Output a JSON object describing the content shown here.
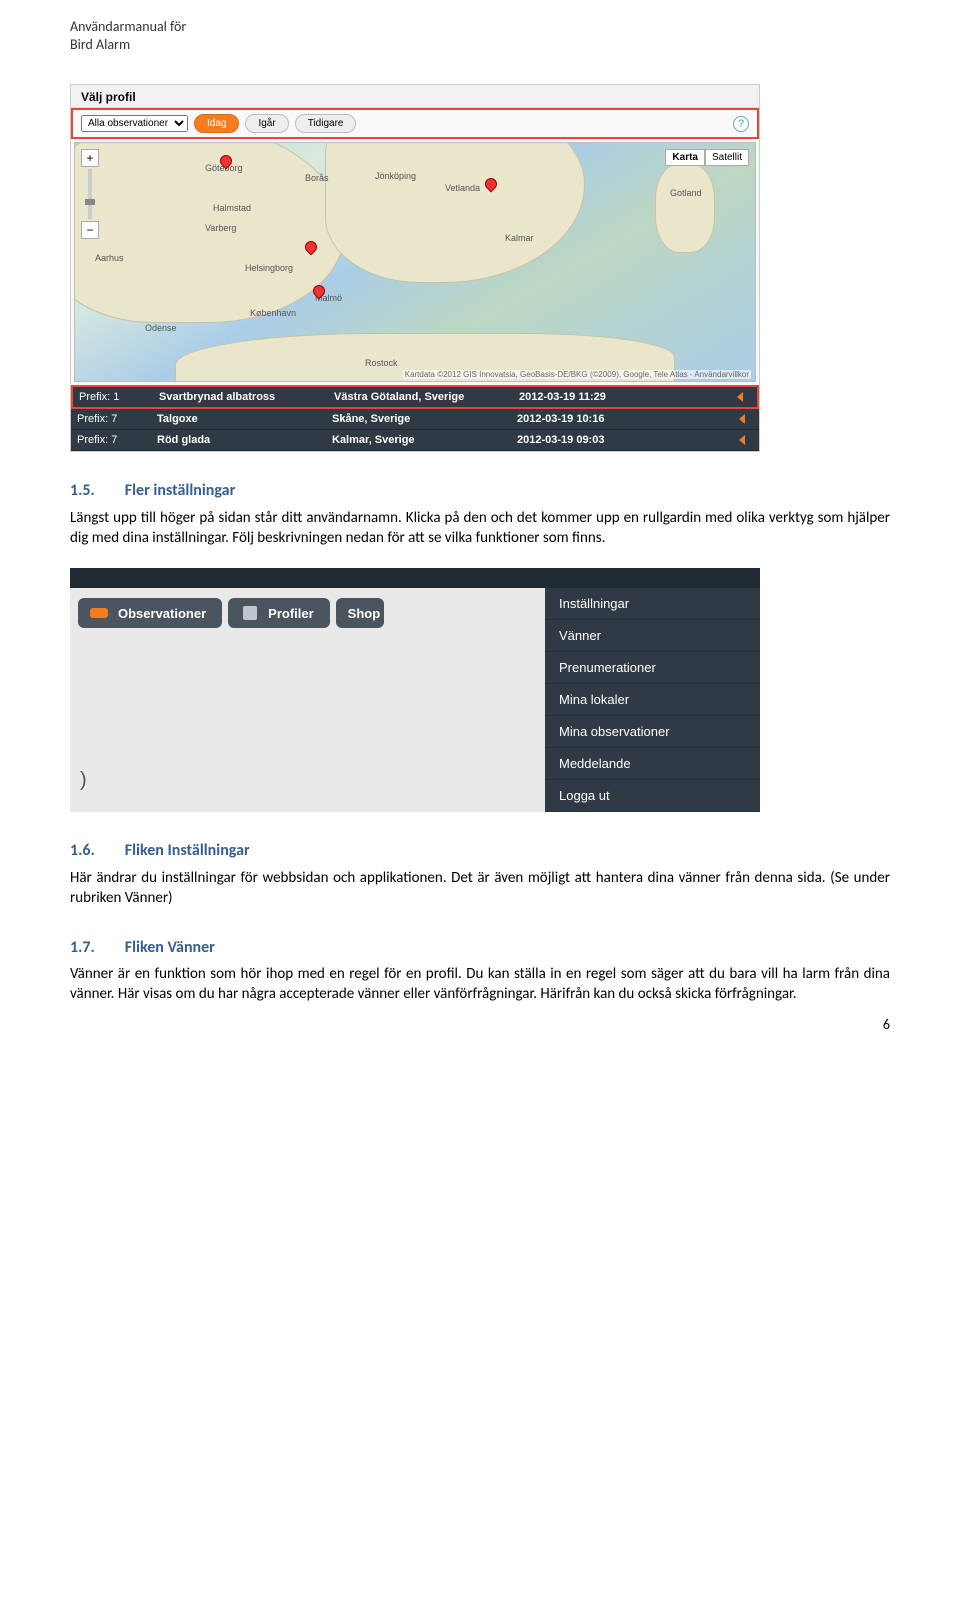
{
  "header": {
    "line1": "Användarmanual för",
    "line2": "Bird Alarm"
  },
  "shot1": {
    "profileLabel": "Välj profil",
    "dropdown": "Alla observationer",
    "btnIdag": "Idag",
    "btnIgar": "Igår",
    "btnTidigare": "Tidigare",
    "mapKarta": "Karta",
    "mapSatellit": "Satellit",
    "attrib": "Kartdata ©2012 GIS Innovatsia, GeoBasis-DE/BKG (©2009), Google, Tele Atlas - Användarvillkor",
    "labels": {
      "goteborg": "Göteborg",
      "halmstad": "Halmstad",
      "boras": "Borås",
      "jonkoping": "Jönköping",
      "vetlanda": "Vetlanda",
      "varberg": "Varberg",
      "helsingborg": "Helsingborg",
      "malmo": "Malmö",
      "kobenhavn": "København",
      "odense": "Odense",
      "aarhus": "Aarhus",
      "gotland": "Gotland",
      "rostock": "Rostock",
      "kalmar": "Kalmar"
    },
    "rows": [
      {
        "prefix": "Prefix: 1",
        "bird": "Svartbrynad albatross",
        "place": "Västra Götaland, Sverige",
        "time": "2012-03-19 11:29"
      },
      {
        "prefix": "Prefix: 7",
        "bird": "Talgoxe",
        "place": "Skåne, Sverige",
        "time": "2012-03-19 10:16"
      },
      {
        "prefix": "Prefix: 7",
        "bird": "Röd glada",
        "place": "Kalmar, Sverige",
        "time": "2012-03-19 09:03"
      }
    ]
  },
  "sec15": {
    "num": "1.5.",
    "title": "Fler inställningar",
    "body": "Längst upp till höger på sidan står ditt användarnamn. Klicka på den och det kommer upp en rullgardin med olika verktyg som hjälper dig med dina inställningar. Följ beskrivningen nedan för att se vilka funktioner som finns."
  },
  "shot2": {
    "tabObs": "Observationer",
    "tabProfiler": "Profiler",
    "tabShop": "Shop",
    "menu": [
      "Inställningar",
      "Vänner",
      "Prenumerationer",
      "Mina lokaler",
      "Mina observationer",
      "Meddelande",
      "Logga ut"
    ]
  },
  "sec16": {
    "num": "1.6.",
    "title": "Fliken Inställningar",
    "body": "Här ändrar du inställningar för webbsidan och applikationen. Det är även möjligt att hantera dina vänner från denna sida. (Se under rubriken Vänner)"
  },
  "sec17": {
    "num": "1.7.",
    "title": "Fliken Vänner",
    "body": "Vänner är en funktion som hör ihop med en regel för en profil. Du kan ställa in en regel som säger att du bara vill ha larm från dina vänner. Här visas om du har några accepterade vänner eller vänförfrågningar. Härifrån kan du också skicka förfrågningar."
  },
  "pageNumber": "6"
}
